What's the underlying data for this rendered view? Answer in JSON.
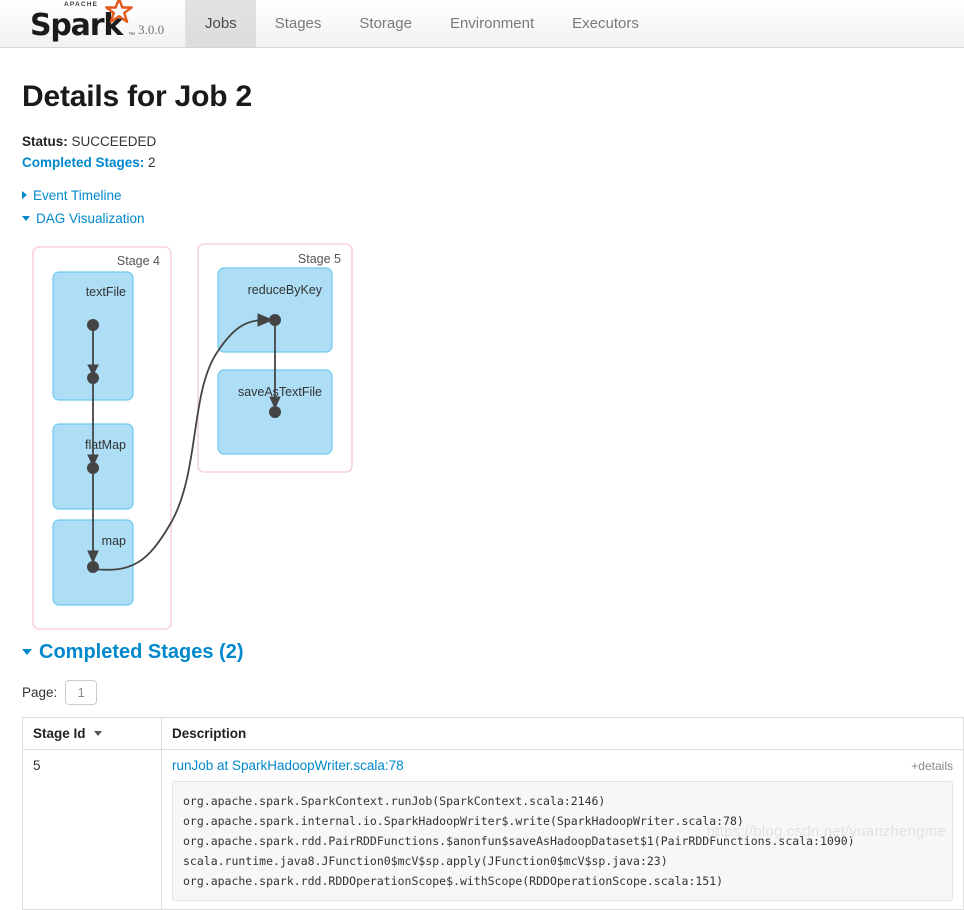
{
  "navbar": {
    "brand": {
      "apache": "APACHE",
      "spark": "Spark",
      "trademark": "™",
      "version": "3.0.0",
      "star_color": "#e25a1c"
    },
    "tabs": [
      {
        "label": "Jobs",
        "active": true
      },
      {
        "label": "Stages",
        "active": false
      },
      {
        "label": "Storage",
        "active": false
      },
      {
        "label": "Environment",
        "active": false
      },
      {
        "label": "Executors",
        "active": false
      }
    ]
  },
  "page": {
    "title": "Details for Job 2",
    "status_label": "Status:",
    "status_value": "SUCCEEDED",
    "completed_stages_label": "Completed Stages:",
    "completed_stages_value": "2",
    "event_timeline_label": "Event Timeline",
    "dag_visualization_label": "DAG Visualization"
  },
  "dag": {
    "stage_border_color": "#f7d3dc",
    "rdd_fill_color": "#addef5",
    "rdd_border_color": "#6fc9ef",
    "edge_color": "#444444",
    "stages": [
      {
        "title": "Stage 4",
        "rdds": [
          {
            "label": "textFile"
          },
          {
            "label": "flatMap"
          },
          {
            "label": "map"
          }
        ]
      },
      {
        "title": "Stage 5",
        "rdds": [
          {
            "label": "reduceByKey"
          },
          {
            "label": "saveAsTextFile"
          }
        ]
      }
    ]
  },
  "completed_stages": {
    "heading": "Completed Stages (2)",
    "page_label": "Page:",
    "page_value": "1",
    "columns": [
      "Stage Id",
      "Description"
    ],
    "rows": [
      {
        "stage_id": "5",
        "description_link": "runJob at SparkHadoopWriter.scala:78",
        "details_label": "+details",
        "stacktrace": "org.apache.spark.SparkContext.runJob(SparkContext.scala:2146)\norg.apache.spark.internal.io.SparkHadoopWriter$.write(SparkHadoopWriter.scala:78)\norg.apache.spark.rdd.PairRDDFunctions.$anonfun$saveAsHadoopDataset$1(PairRDDFunctions.scala:1090)\nscala.runtime.java8.JFunction0$mcV$sp.apply(JFunction0$mcV$sp.java:23)\norg.apache.spark.rdd.RDDOperationScope$.withScope(RDDOperationScope.scala:151)"
      }
    ]
  },
  "watermark": {
    "text": "https://blog.csdn.net/yuanzhengme"
  }
}
